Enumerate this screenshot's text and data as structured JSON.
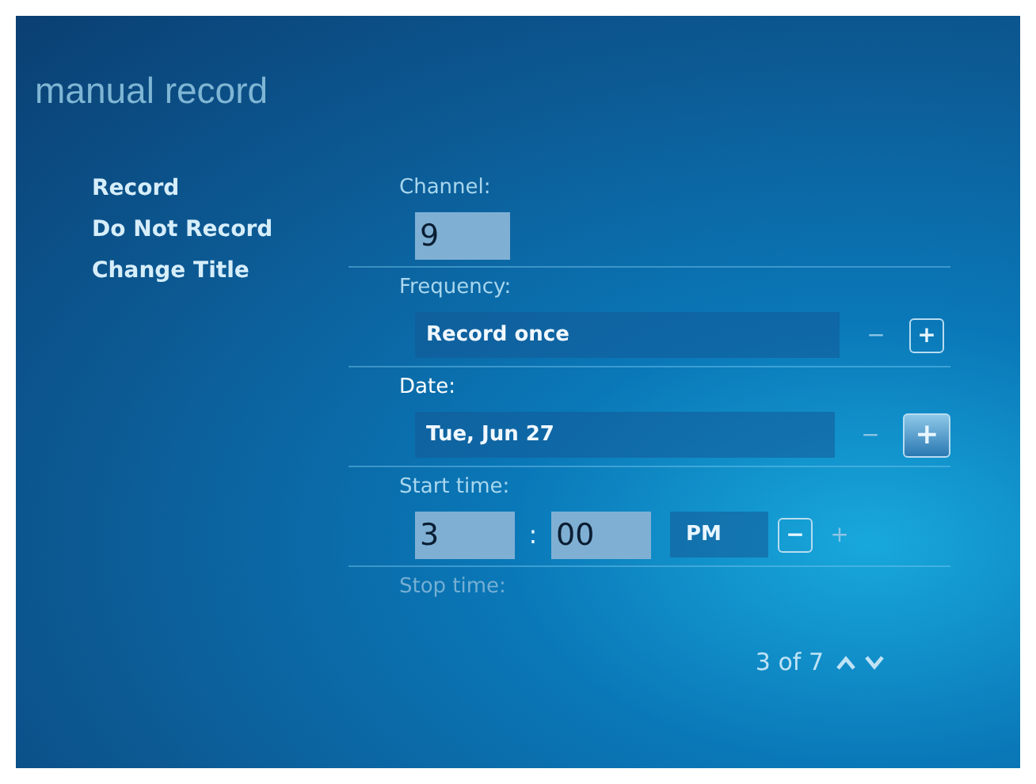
{
  "title": "manual record",
  "menu": [
    {
      "label": "Record"
    },
    {
      "label": "Do Not Record"
    },
    {
      "label": "Change Title"
    }
  ],
  "fields": [
    {
      "kind": "number",
      "label": "Channel:",
      "value": "9",
      "focused": false
    },
    {
      "kind": "spinner",
      "label": "Frequency:",
      "value": "Record once",
      "minus": "−",
      "plus": "+",
      "minus_disabled": true,
      "plus_disabled": false,
      "focused": false
    },
    {
      "kind": "spinner",
      "label": "Date:",
      "value": "Tue, Jun 27",
      "minus": "−",
      "plus": "+",
      "minus_disabled": true,
      "plus_disabled": false,
      "focused": true
    },
    {
      "kind": "time",
      "label": "Start time:",
      "hour": "3",
      "separator": ":",
      "minute": "00",
      "ampm": "PM",
      "minus": "−",
      "plus": "+",
      "minus_disabled": false,
      "plus_disabled": true,
      "focused": false
    },
    {
      "kind": "label",
      "label": "Stop time:",
      "focused": false
    }
  ],
  "pager": {
    "text": "3 of 7"
  }
}
